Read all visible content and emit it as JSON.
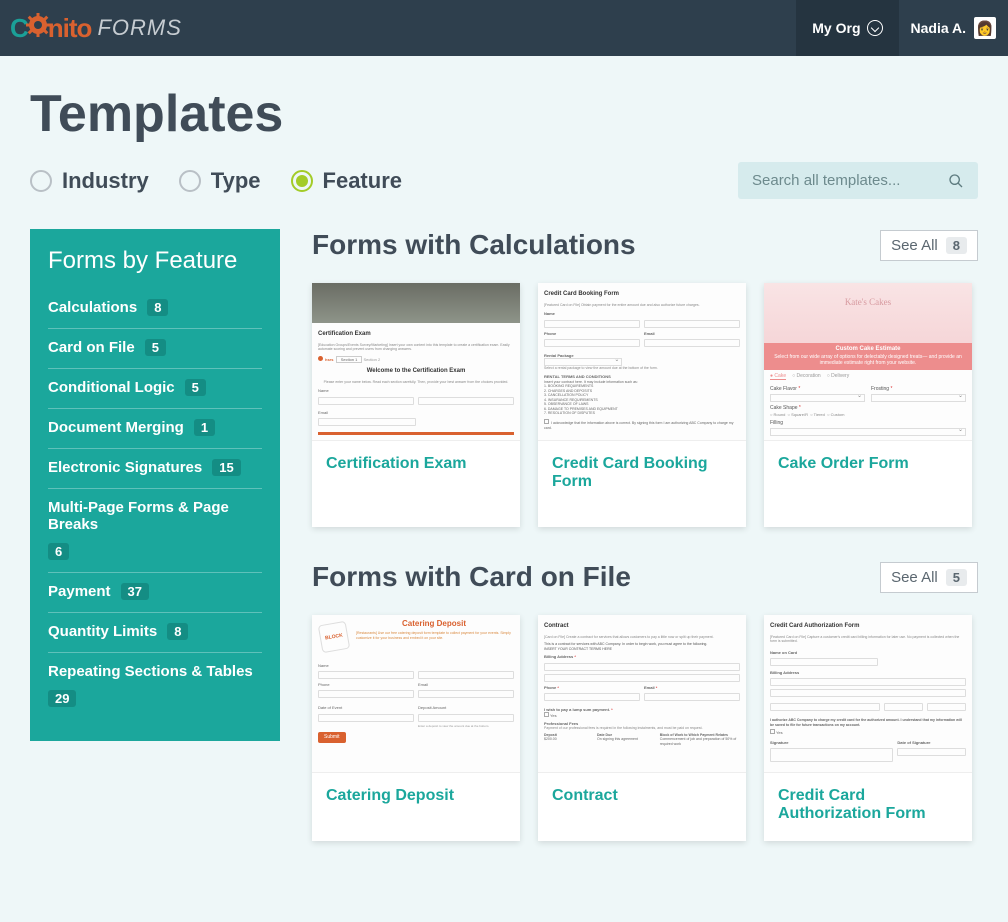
{
  "header": {
    "logo_text_forms": "FORMS",
    "org_label": "My Org",
    "user_name": "Nadia A.",
    "avatar_emoji": "👩"
  },
  "page": {
    "title": "Templates"
  },
  "filters": {
    "industry": "Industry",
    "type": "Type",
    "feature": "Feature"
  },
  "search": {
    "placeholder": "Search all templates..."
  },
  "sidebar": {
    "title": "Forms by Feature",
    "items": [
      {
        "label": "Calculations",
        "count": "8"
      },
      {
        "label": "Card on File",
        "count": "5"
      },
      {
        "label": "Conditional Logic",
        "count": "5"
      },
      {
        "label": "Document Merging",
        "count": "1"
      },
      {
        "label": "Electronic Signatures",
        "count": "15"
      },
      {
        "label": "Multi-Page Forms & Page Breaks",
        "count": "6"
      },
      {
        "label": "Payment",
        "count": "37"
      },
      {
        "label": "Quantity Limits",
        "count": "8"
      },
      {
        "label": "Repeating Sections & Tables",
        "count": "29"
      }
    ]
  },
  "sections": [
    {
      "title": "Forms with Calculations",
      "see_all_label": "See All",
      "count": "8",
      "cards": [
        {
          "title": "Certification Exam"
        },
        {
          "title": "Credit Card Booking Form"
        },
        {
          "title": "Cake Order Form"
        }
      ]
    },
    {
      "title": "Forms with Card on File",
      "see_all_label": "See All",
      "count": "5",
      "cards": [
        {
          "title": "Catering Deposit"
        },
        {
          "title": "Contract"
        },
        {
          "title": "Credit Card Authorization Form"
        }
      ]
    }
  ],
  "thumbs": {
    "cert": {
      "heading": "Certification Exam",
      "tag": "[Education Groups/Events Survey/Marketing] Insert your own content into this template to create a certification exam. Easily automate scoring and prevent users from changing answers.",
      "sec1": "Section 1",
      "sec2": "Section 2",
      "welcome": "Welcome to the Certification Exam",
      "inst": "Please enter your name below. Read each section carefully. Then, provide your best answer from the choices provided.",
      "name": "Name",
      "email": "Email"
    },
    "ccbook": {
      "heading": "Credit Card Booking Form",
      "tag": "[Featured Card on File] Obtain payment for the entire amount due and also authorize future charges.",
      "name": "Name",
      "phone": "Phone",
      "email": "Email",
      "rental": "Rental Package",
      "pick": "Select a rental package to view the amount due at the bottom of the form.",
      "terms": "RENTAL TERMS AND CONDITIONS",
      "l1": "1. BOOKING REQUIREMENTS",
      "l2": "2. CHARGES AND DEPOSITS",
      "l3": "3. CANCELLATION POLICY",
      "l4": "4. INSURANCE REQUIREMENTS",
      "l5": "5. OBSERVANCE OF LAWS",
      "l6": "6. DAMAGE TO PREMISES AND EQUIPMENT",
      "l7": "7. RESOLUTION OF DISPUTES",
      "ack": "I acknowledge that the information above is correct. By signing this form I am authorizing ABC Company to charge my card."
    },
    "cake": {
      "brand": "Kate's Cakes",
      "subtitle": "Custom Cake Estimate",
      "subline": "Select from our wide array of options for delectably designed treats— and provide an immediate estimate right from your website.",
      "tab1": "Cake",
      "tab2": "Decoration",
      "tab3": "Delivery",
      "flavor": "Cake Flavor",
      "frosting": "Frosting",
      "shape": "Cake Shape",
      "opt1": "Round",
      "opt2": "Square/R",
      "opt3": "Tiered",
      "opt4": "Custom",
      "filling": "Filling"
    },
    "catering": {
      "logo": "BLOCK",
      "heading": "Catering Deposit",
      "tag": "[Restaurants] Use our free catering deposit form template to collect payment for your events. Simply customize it for your business and embed it on your site.",
      "name": "Name",
      "phone": "Phone",
      "email": "Email",
      "date": "Date of Event",
      "deposit": "Deposit Amount",
      "depnote": "Enter a deposit to view the amount due at the bottom.",
      "submit": "Submit"
    },
    "contract": {
      "heading": "Contract",
      "tag": "[Card on File] Create a contract for services that allows customers to pay a little now or split up their payment.",
      "intro": "This is a contract for services with ABC Company. In order to begin work, you must agree to the following.",
      "insert": "INSERT YOUR CONTRACT TERMS HERE",
      "billing": "Billing Address",
      "phone": "Phone",
      "email": "Email",
      "wish": "I wish to pay a lump sum payment.",
      "yes": "Yes",
      "prof": "Professional Fees",
      "depnote": "Payment of our professional fees is required in the following instalments, and must be paid on request.",
      "deposit": "Deposit",
      "amount": "$200.00",
      "due": "Date Due",
      "ondoc": "On signing this agreement",
      "block": "Block of Work to Which Payment Relates",
      "comm": "Commencement of job and preparation of 50% of required work"
    },
    "ccauth": {
      "heading": "Credit Card Authorization Form",
      "tag": "[Featured Card on File] Capture a customer's credit card billing information for later use. No payment is collected when the form is submitted.",
      "nameoncard": "Name on Card",
      "billing": "Billing Address",
      "auth": "I authorize ABC Company to charge my credit card for the authorized amount. I understand that my information will be saved to file for future transactions on my account.",
      "yes": "Yes",
      "sig": "Signature",
      "sigdate": "Date of Signature"
    }
  }
}
